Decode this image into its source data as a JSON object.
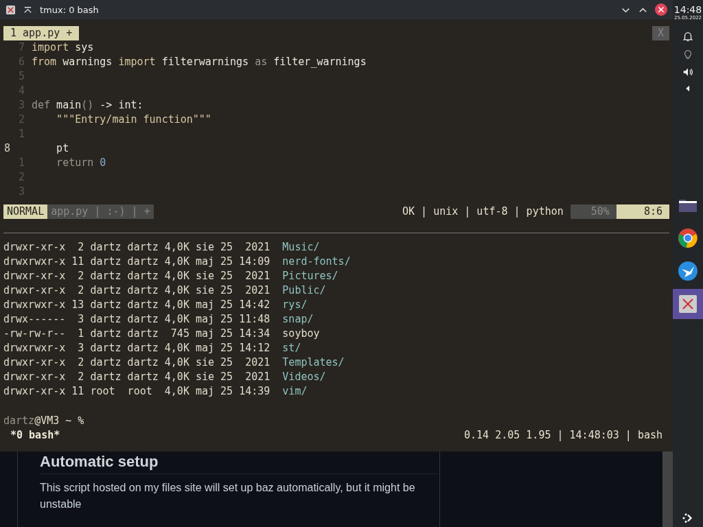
{
  "window": {
    "title": "tmux: 0 bash"
  },
  "editor": {
    "tabs": [
      {
        "label": "1 app.py +",
        "selected": true
      }
    ],
    "close_label": "X",
    "lines": [
      {
        "number": "7",
        "current": false,
        "tokens": [
          {
            "text": "import",
            "kind": "keyword"
          },
          {
            "text": " sys",
            "kind": "name"
          }
        ]
      },
      {
        "number": "6",
        "current": false,
        "tokens": [
          {
            "text": "from",
            "kind": "keyword"
          },
          {
            "text": " warnings ",
            "kind": "name"
          },
          {
            "text": "import",
            "kind": "keyword"
          },
          {
            "text": " filterwarnings ",
            "kind": "name"
          },
          {
            "text": "as",
            "kind": "dim"
          },
          {
            "text": " filter_warnings",
            "kind": "name"
          }
        ]
      },
      {
        "number": "5",
        "current": false
      },
      {
        "number": "4",
        "current": false
      },
      {
        "number": "3",
        "current": false,
        "tokens": [
          {
            "text": "def",
            "kind": "dim"
          },
          {
            "text": " main",
            "kind": "name"
          },
          {
            "text": "()",
            "kind": "dim"
          },
          {
            "text": " -> int:",
            "kind": "name"
          }
        ]
      },
      {
        "number": "2",
        "current": false,
        "tokens": [
          {
            "text": "    \"\"\"Entry/main function\"\"\"",
            "kind": "keyword"
          }
        ]
      },
      {
        "number": "1",
        "current": false
      },
      {
        "number": "8",
        "current": true,
        "tokens": [
          {
            "text": "    pt",
            "kind": "name"
          }
        ]
      },
      {
        "number": "1",
        "current": false,
        "tokens": [
          {
            "text": "    return ",
            "kind": "dim"
          },
          {
            "text": "0",
            "kind": "number"
          }
        ]
      },
      {
        "number": "2",
        "current": false
      },
      {
        "number": "3",
        "current": false
      }
    ],
    "status": {
      "mode": "NORMAL",
      "file": "app.py | :-) | +",
      "info": "OK | unix | utf-8 | python",
      "percent": "50%",
      "position": "8:6"
    }
  },
  "listing": [
    {
      "meta": "drwxr-xr-x  2 dartz dartz 4,0K sie 25  2021",
      "name": "Music/",
      "kind": "dir"
    },
    {
      "meta": "drwxrwxr-x 11 dartz dartz 4,0K maj 25 14:09",
      "name": "nerd-fonts/",
      "kind": "dir"
    },
    {
      "meta": "drwxr-xr-x  2 dartz dartz 4,0K sie 25  2021",
      "name": "Pictures/",
      "kind": "dir"
    },
    {
      "meta": "drwxr-xr-x  2 dartz dartz 4,0K sie 25  2021",
      "name": "Public/",
      "kind": "dir"
    },
    {
      "meta": "drwxrwxr-x 13 dartz dartz 4,0K maj 25 14:42",
      "name": "rys/",
      "kind": "dir"
    },
    {
      "meta": "drwx------  3 dartz dartz 4,0K maj 25 11:48",
      "name": "snap/",
      "kind": "dir"
    },
    {
      "meta": "-rw-rw-r--  1 dartz dartz  745 maj 25 14:34",
      "name": "soyboy",
      "kind": "file"
    },
    {
      "meta": "drwxrwxr-x  3 dartz dartz 4,0K maj 25 14:12",
      "name": "st/",
      "kind": "dir"
    },
    {
      "meta": "drwxr-xr-x  2 dartz dartz 4,0K sie 25  2021",
      "name": "Templates/",
      "kind": "dir"
    },
    {
      "meta": "drwxr-xr-x  2 dartz dartz 4,0K sie 25  2021",
      "name": "Videos/",
      "kind": "dir"
    },
    {
      "meta": "drwxr-xr-x 11 root  root  4,0K maj 25 14:39",
      "name": "vim/",
      "kind": "dir"
    }
  ],
  "prompt": {
    "user": "dartz",
    "host": "@VM3 ~ %"
  },
  "tmux_status": {
    "window": "*0 bash*",
    "right": "0.14 2.05 1.95 | 14:48:03 | bash"
  },
  "webpage": {
    "heading": "Automatic setup",
    "paragraph": "This script hosted on my files site will set up baz automatically, but it might be unstable"
  },
  "panel": {
    "time": "14:48",
    "date": "25.05.2022",
    "tasks": [
      {
        "kind": "files",
        "selected": false
      },
      {
        "kind": "browser",
        "selected": false
      },
      {
        "kind": "bird",
        "selected": false
      },
      {
        "kind": "xapp",
        "selected": true
      }
    ]
  }
}
